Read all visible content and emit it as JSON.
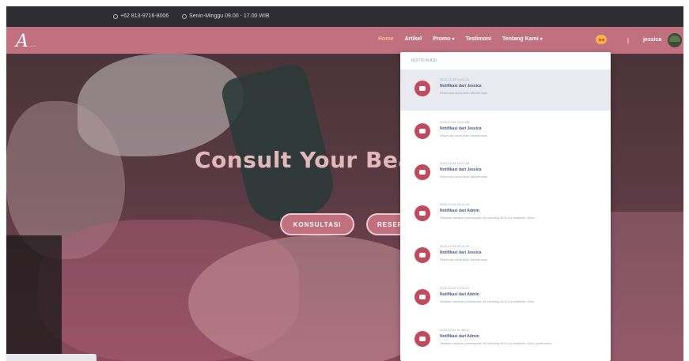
{
  "topbar": {
    "phone": "+62 813-9716-8006",
    "hours": "Senin-Minggu 09.00 - 17.00 WIB"
  },
  "navbar": {
    "logo": "A",
    "logo_sub": "...",
    "items": [
      {
        "label": "Home",
        "active": true
      },
      {
        "label": "Artikel"
      },
      {
        "label": "Promo"
      },
      {
        "label": "Testimoni"
      },
      {
        "label": "Tentang Kami"
      }
    ],
    "separator": "|",
    "user_name": "jessica"
  },
  "hero": {
    "title": "Consult Your Beau",
    "btn_konsultasi": "KONSULTASI",
    "btn_reservasi": "RESER"
  },
  "notifications": {
    "header": "Notifikasi",
    "items": [
      {
        "date": "2023-12-05 10:03:21",
        "title": "Notifikasi dari Jessica",
        "text": "Reservasi anda telah dikonfirmasi"
      },
      {
        "date": "2023-12-05 10:02:55",
        "title": "Notifikasi dari Jessica",
        "text": "Reservasi anda telah dikonfirmasi"
      },
      {
        "date": "2023-12-04 16:21:08",
        "title": "Notifikasi dari Jessica",
        "text": "Reservasi anda telah dikonfirmasi"
      },
      {
        "date": "2023-12-04 16:19:42",
        "title": "Notifikasi dari Admin",
        "text": "Silahkan lakukan pembayaran ke rekening BCA a.n Aesthetic Clinic"
      },
      {
        "date": "2023-12-03 09:11:30",
        "title": "Notifikasi dari Jessica",
        "text": "Reservasi anda telah dikonfirmasi"
      },
      {
        "date": "2023-12-02 14:02:17",
        "title": "Notifikasi dari Admin",
        "text": "Silahkan lakukan pembayaran ke rekening BCA a.n Aesthetic Clinic"
      },
      {
        "date": "2023-12-01 11:45:02",
        "title": "Notifikasi dari Admin",
        "text": "Silahkan lakukan pembayaran ke rekening BCA a.n Aesthetic Clinic (konfirmasi)"
      }
    ]
  },
  "colors": {
    "navbar": "#c0707e",
    "topbar": "#2e2e30",
    "accent": "#c04a5e"
  }
}
